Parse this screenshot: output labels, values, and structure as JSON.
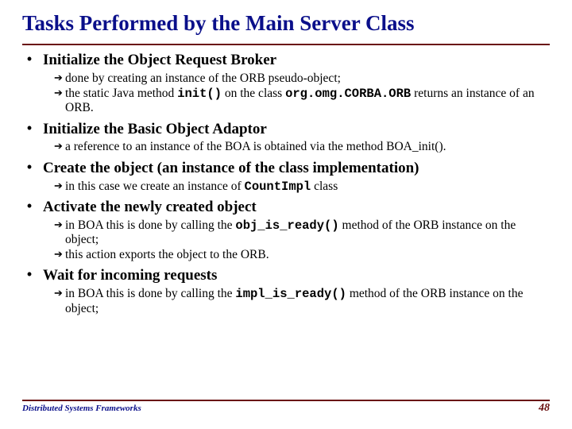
{
  "title": "Tasks Performed by the Main Server Class",
  "items": [
    {
      "heading": "Initialize the Object Request Broker",
      "subs": [
        "done by creating an instance of the ORB pseudo-object;",
        "the static Java method <span class=\"mono\">init()</span> on the class <span class=\"mono\">org.omg.CORBA.ORB</span> returns an instance of an ORB."
      ]
    },
    {
      "heading": "Initialize the Basic Object Adaptor",
      "subs": [
        "a reference to an instance of the BOA is obtained via the method BOA_init()."
      ]
    },
    {
      "heading": "Create the object (an instance of the class implementation)",
      "subs": [
        "in this case we create an instance of <span class=\"mono\">CountImpl</span> class"
      ]
    },
    {
      "heading": "Activate the newly created object",
      "subs": [
        "in BOA this is done by calling the <span class=\"mono\">obj_is_ready()</span> method of the ORB instance on the object;",
        "this action exports the object to the ORB."
      ]
    },
    {
      "heading": "Wait for incoming requests",
      "subs": [
        "in BOA this is done by calling the <span class=\"mono\">impl_is_ready()</span> method of the ORB instance on the object;"
      ]
    }
  ],
  "footer": {
    "left": "Distributed Systems Frameworks",
    "page": "48"
  }
}
